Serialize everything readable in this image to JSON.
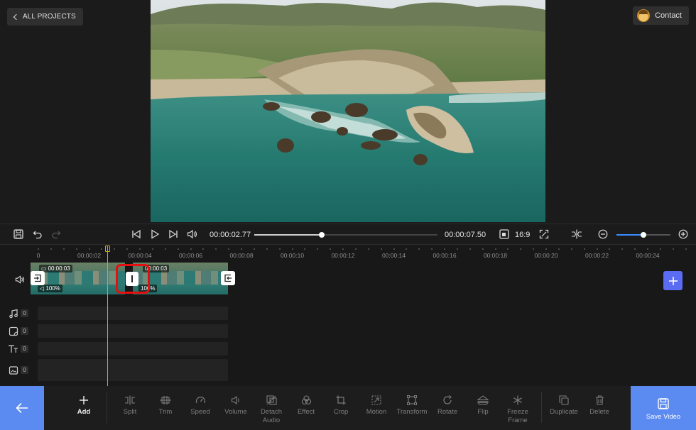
{
  "header": {
    "back_label": "ALL PROJECTS",
    "contact_label": "Contact"
  },
  "player": {
    "current_time": "00:00:02.77",
    "total_time": "00:00:07.50",
    "progress": 0.37,
    "aspect_ratio": "16:9",
    "zoom_level": 0.5
  },
  "timeline": {
    "ticks": [
      "0",
      "00:00:02",
      "00:00:04",
      "00:00:06",
      "00:00:08",
      "00:00:10",
      "00:00:12",
      "00:00:14",
      "00:00:16",
      "00:00:18",
      "00:00:20",
      "00:00:22",
      "00:00:24"
    ],
    "clips": [
      {
        "duration": "00:00:03",
        "volume": "100%"
      },
      {
        "duration": "00:00:03",
        "volume": "100%"
      }
    ],
    "tracks": [
      {
        "icon": "music-icon",
        "count": "0"
      },
      {
        "icon": "sticker-icon",
        "count": "0"
      },
      {
        "icon": "text-icon",
        "count": "0"
      },
      {
        "icon": "image-icon",
        "count": "0"
      }
    ]
  },
  "toolbar": {
    "add": "Add",
    "split": "Split",
    "trim": "Trim",
    "speed": "Speed",
    "volume": "Volume",
    "detach_audio_1": "Detach",
    "detach_audio_2": "Audio",
    "effect": "Effect",
    "crop": "Crop",
    "motion": "Motion",
    "transform": "Transform",
    "rotate": "Rotate",
    "flip": "Flip",
    "freeze_frame_1": "Freeze",
    "freeze_frame_2": "Frame",
    "duplicate": "Duplicate",
    "delete": "Delete",
    "save_video": "Save Video"
  },
  "colors": {
    "accent": "#5b8af0",
    "playhead": "#d4a21c",
    "highlight": "#e41010",
    "add_track": "#5a6cf2"
  }
}
